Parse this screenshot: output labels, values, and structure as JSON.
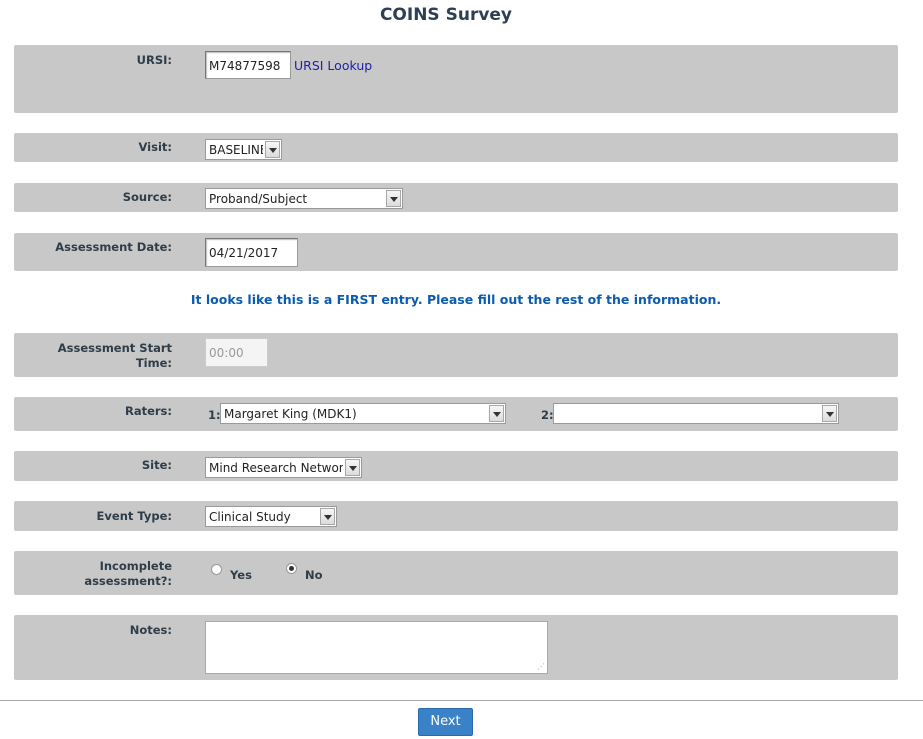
{
  "page": {
    "title": "COINS Survey"
  },
  "ursi": {
    "label": "URSI:",
    "value": "M74877598",
    "lookup_link": "URSI Lookup"
  },
  "visit": {
    "label": "Visit:",
    "selected": "BASELINE"
  },
  "source": {
    "label": "Source:",
    "selected": "Proband/Subject"
  },
  "assessment_date": {
    "label": "Assessment Date:",
    "value": "04/21/2017"
  },
  "notice": "It looks like this is a FIRST entry. Please fill out the rest of the information.",
  "start_time": {
    "label_line1": "Assessment Start",
    "label_line2": "Time:",
    "placeholder": "00:00"
  },
  "raters": {
    "label": "Raters:",
    "rater1_num": "1:",
    "rater1_selected": "Margaret King (MDK1)",
    "rater2_num": "2:",
    "rater2_selected": ""
  },
  "site": {
    "label": "Site:",
    "selected": "Mind Research Network"
  },
  "event_type": {
    "label": "Event Type:",
    "selected": "Clinical Study"
  },
  "incomplete": {
    "label_line1": "Incomplete",
    "label_line2": "assessment?:",
    "yes_label": "Yes",
    "no_label": "No",
    "selected": "No"
  },
  "notes": {
    "label": "Notes:",
    "value": ""
  },
  "next_button": "Next"
}
